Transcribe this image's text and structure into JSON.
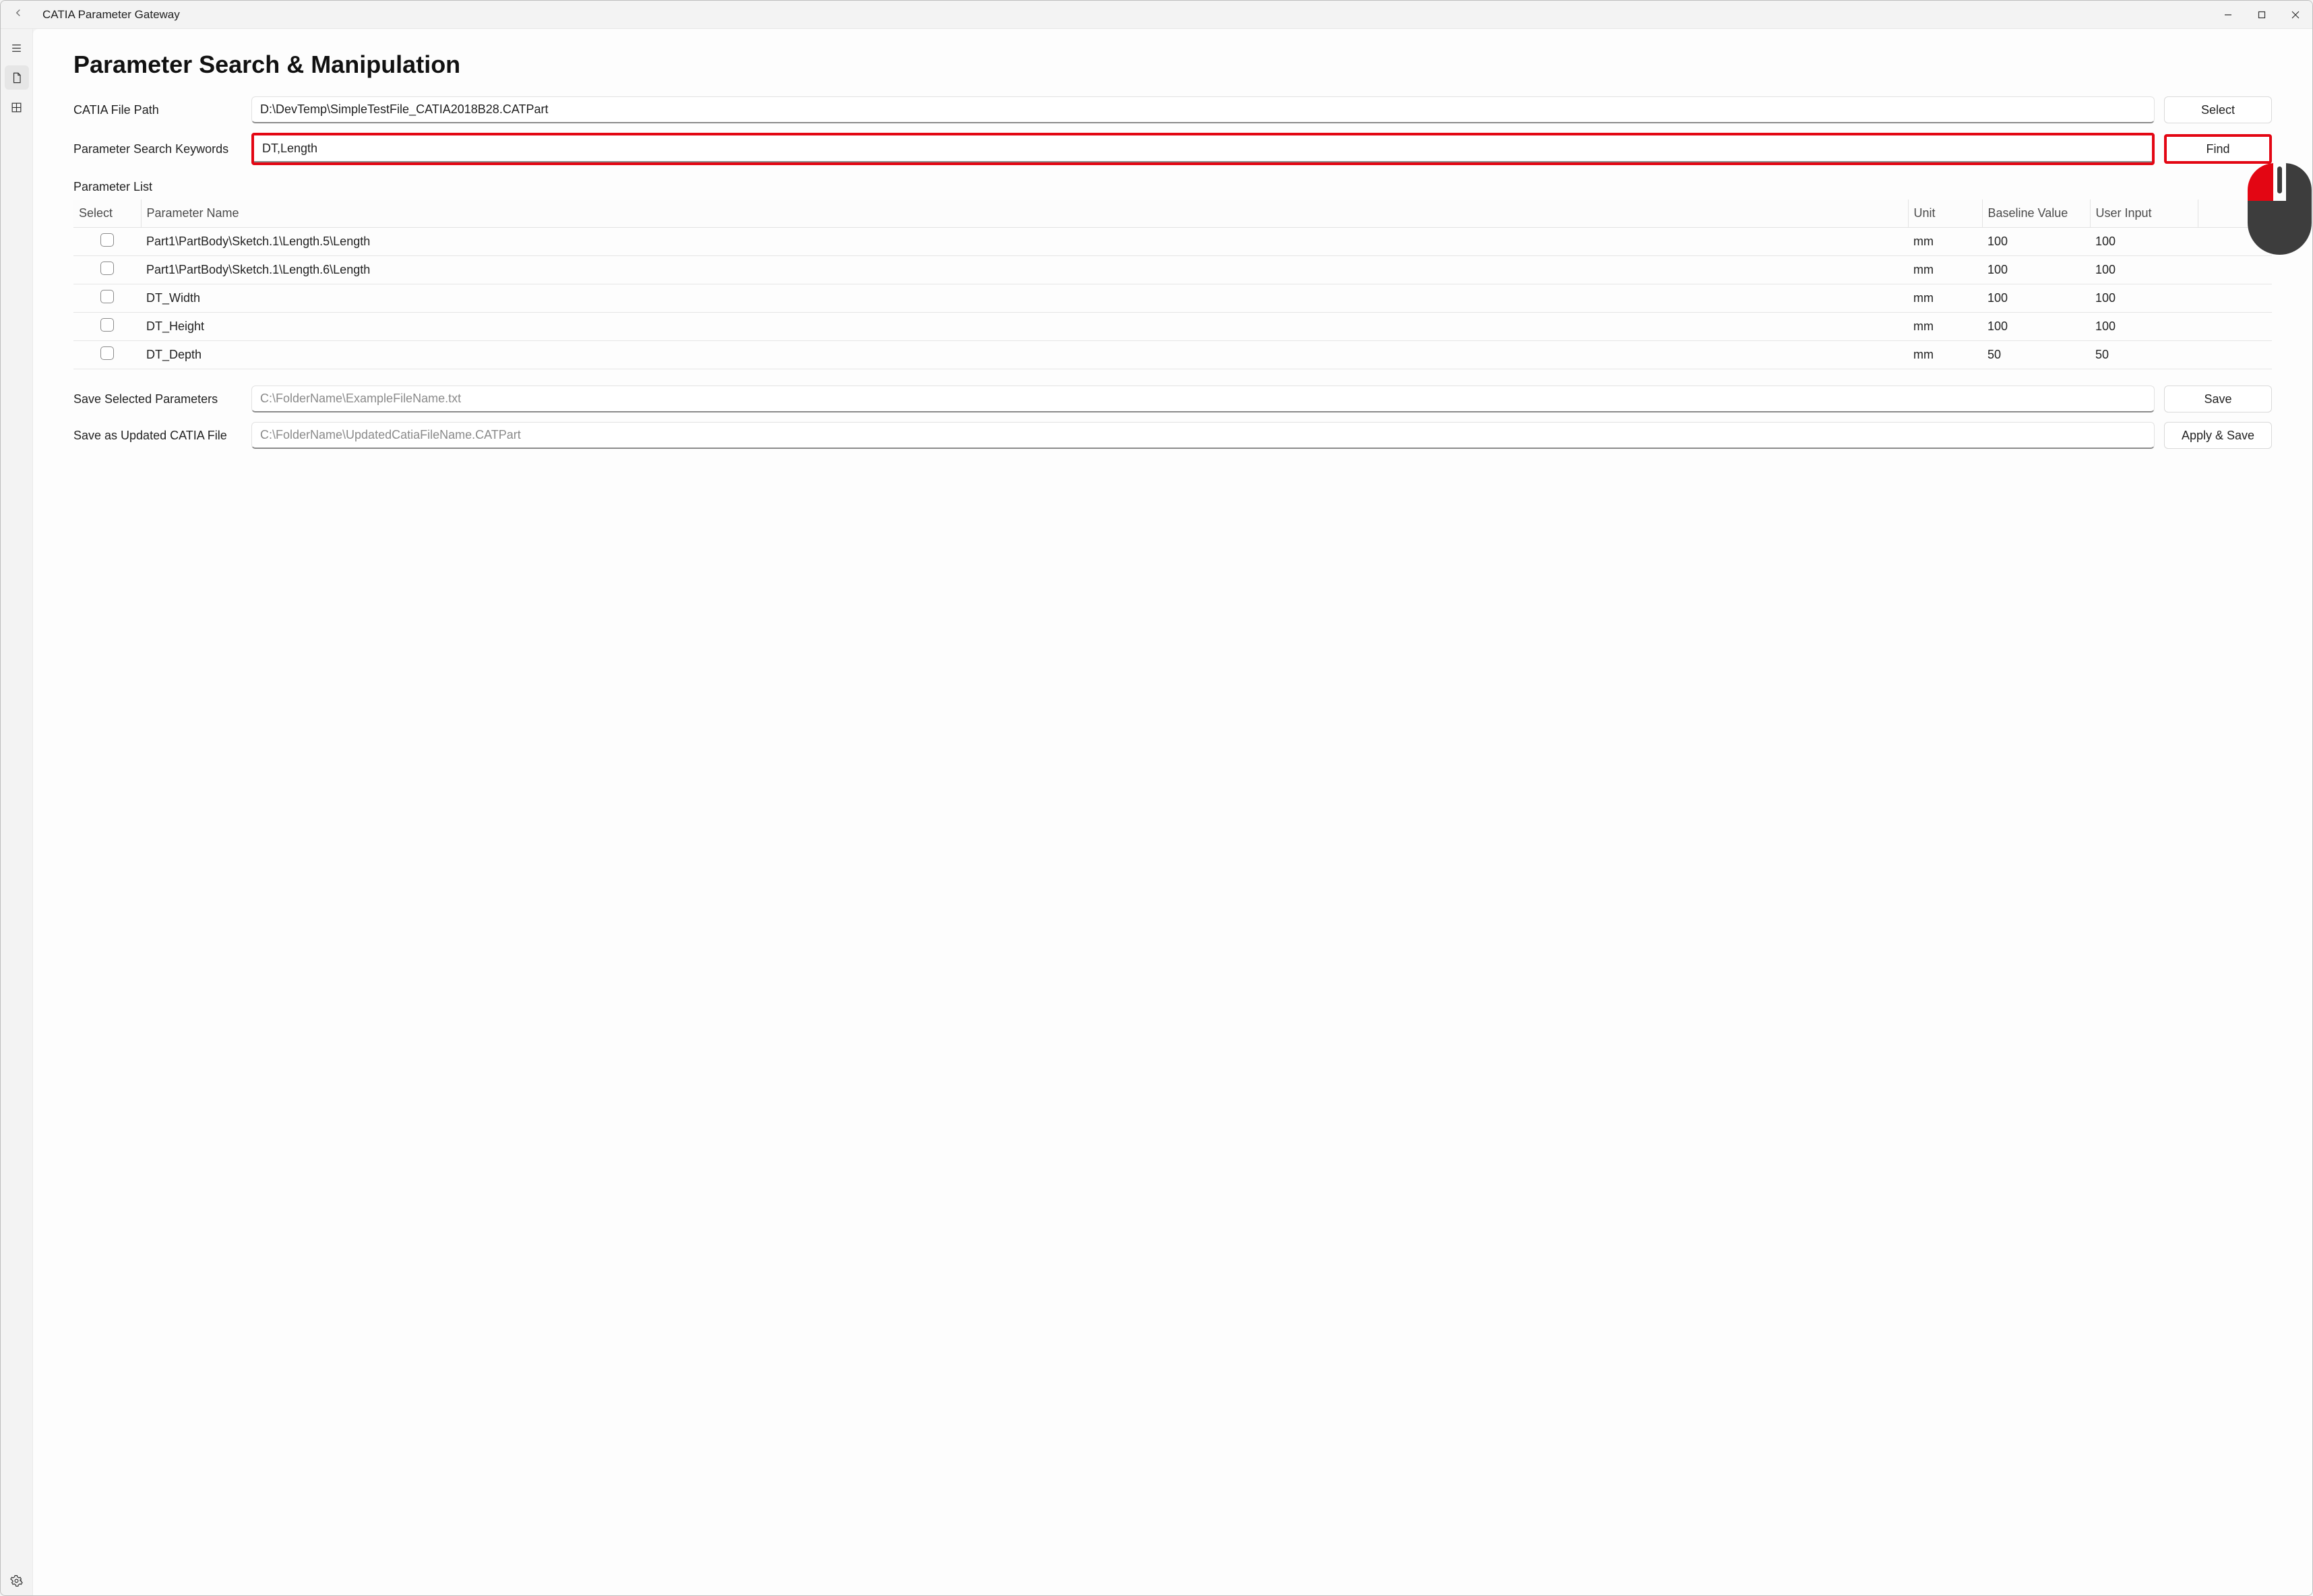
{
  "window": {
    "title": "CATIA Parameter Gateway"
  },
  "page": {
    "heading": "Parameter Search & Manipulation",
    "file_path_label": "CATIA File Path",
    "file_path_value": "D:\\DevTemp\\SimpleTestFile_CATIA2018B28.CATPart",
    "select_button": "Select",
    "keywords_label": "Parameter Search Keywords",
    "keywords_value": "DT,Length",
    "find_button": "Find",
    "param_list_label": "Parameter List",
    "columns": {
      "select": "Select",
      "name": "Parameter Name",
      "unit": "Unit",
      "baseline": "Baseline Value",
      "user": "User Input"
    },
    "rows": [
      {
        "name": "Part1\\PartBody\\Sketch.1\\Length.5\\Length",
        "unit": "mm",
        "baseline": "100",
        "user": "100"
      },
      {
        "name": "Part1\\PartBody\\Sketch.1\\Length.6\\Length",
        "unit": "mm",
        "baseline": "100",
        "user": "100"
      },
      {
        "name": "DT_Width",
        "unit": "mm",
        "baseline": "100",
        "user": "100"
      },
      {
        "name": "DT_Height",
        "unit": "mm",
        "baseline": "100",
        "user": "100"
      },
      {
        "name": "DT_Depth",
        "unit": "mm",
        "baseline": "50",
        "user": "50"
      }
    ],
    "save_params_label": "Save Selected Parameters",
    "save_params_placeholder": "C:\\FolderName\\ExampleFileName.txt",
    "save_button": "Save",
    "save_catia_label": "Save as Updated CATIA File",
    "save_catia_placeholder": "C:\\FolderName\\UpdatedCatiaFileName.CATPart",
    "apply_save_button": "Apply & Save"
  }
}
